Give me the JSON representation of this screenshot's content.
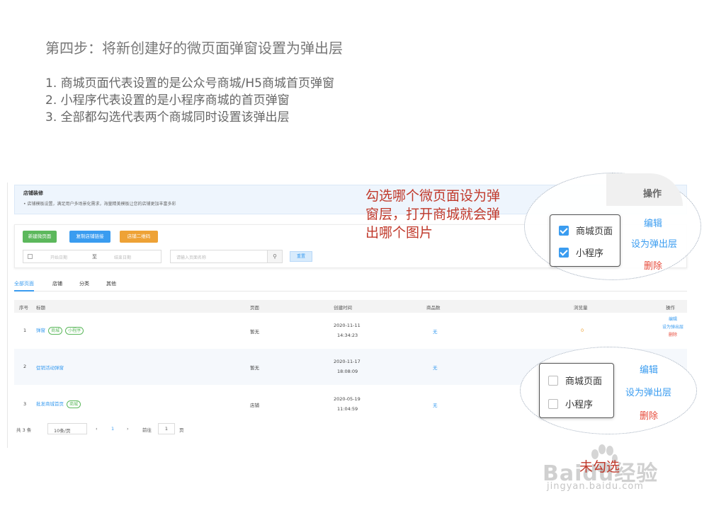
{
  "heading": "第四步：将新创建好的微页面弹窗设置为弹出层",
  "steps": [
    "1. 商城页面代表设置的是公众号商城/H5商城首页弹窗",
    "2. 小程序代表设置的是小程序商城的首页弹窗",
    "3. 全部都勾选代表两个商城同时设置该弹出层"
  ],
  "banner": {
    "title": "店铺装修",
    "desc": "• 店铺模板设置，满足用户多场景化需求，海量精美模板让您的店铺更加丰富多彩"
  },
  "toolbar": {
    "new_page": "新建微页面",
    "copy_link": "复制店铺链接",
    "qr_code": "店铺二维码",
    "start_date": "开始日期",
    "date_sep": "至",
    "end_date": "结束日期",
    "search_placeholder": "请输入页面名称",
    "reset": "重置"
  },
  "tabs": [
    "全部页面",
    "店铺",
    "分类",
    "其他"
  ],
  "table": {
    "headers": [
      "序号",
      "标题",
      "页面",
      "创建时间",
      "商品数",
      "浏览量",
      "操作"
    ],
    "rows": [
      {
        "no": "1",
        "title": "弹窗",
        "tags": [
          "商城",
          "小程序"
        ],
        "page": "暂无",
        "date": "2020-11-11",
        "time": "14:34:23",
        "count": "无",
        "views": "0"
      },
      {
        "no": "2",
        "title": "促销活动弹窗",
        "tags": [],
        "page": "暂无",
        "date": "2020-11-17",
        "time": "18:08:09",
        "count": "无",
        "views": ""
      },
      {
        "no": "3",
        "title": "批发商城首页",
        "tags": [
          "商城"
        ],
        "page": "店铺",
        "date": "2020-05-19",
        "time": "11:04:59",
        "count": "无",
        "views": ""
      }
    ],
    "ops": {
      "edit": "编辑",
      "set_popup": "设为弹出层",
      "delete": "删除"
    }
  },
  "pager": {
    "total": "共 3 条",
    "size": "10条/页",
    "current": "1",
    "goto": "前往",
    "goto_value": "1",
    "page_unit": "页"
  },
  "callout": "勾选哪个微页面设为弹窗层，打开商城就会弹出哪个图片",
  "zoom_checked": {
    "header": "操作",
    "opt1": "商城页面",
    "opt2": "小程序",
    "edit": "编辑",
    "set_popup": "设为弹出层",
    "delete": "删除"
  },
  "zoom_unchecked": {
    "opt1": "商城页面",
    "opt2": "小程序",
    "edit": "编辑",
    "set_popup": "设为弹出层",
    "delete": "删除"
  },
  "note_unchecked": "未勾选",
  "watermark": {
    "text": "Baidu经验",
    "url": "jingyan.baidu.com"
  },
  "colors": {
    "accent": "#3a9cf0",
    "green": "#5cb85c",
    "orange": "#eea236",
    "danger": "#e74c3c",
    "callout": "#c0392b"
  }
}
